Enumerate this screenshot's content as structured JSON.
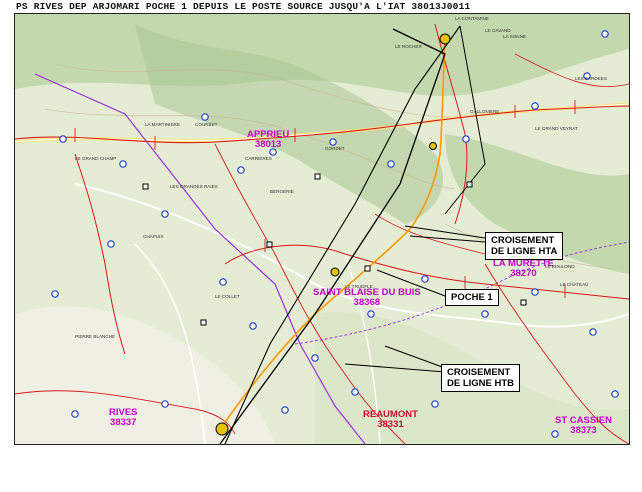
{
  "title": "PS RIVES DEP ARJOMARI POCHE 1 DEPUIS LE POSTE SOURCE JUSQU'A L'IAT 38013J0011",
  "communes": [
    {
      "name": "APPRIEU",
      "code": "38013",
      "color": "#c400c8"
    },
    {
      "name": "LA MURETTE",
      "code": "38270",
      "color": "#c400c8"
    },
    {
      "name": "SAINT BLAISE DU BUIS",
      "code": "38368",
      "color": "#c400c8"
    },
    {
      "name": "RIVES",
      "code": "38337",
      "color": "#c400c8"
    },
    {
      "name": "REAUMONT",
      "code": "38331",
      "color": "#c8102e"
    },
    {
      "name": "ST CASSIEN",
      "code": "38373",
      "color": "#c400c8"
    }
  ],
  "callouts": {
    "hta": "CROISEMENT\nDE LIGNE HTA",
    "poche": "POCHE 1",
    "htb": "CROISEMENT\nDE LIGNE HTB"
  },
  "places": [
    "LE GRAND CHAMP",
    "LA MARTINIERE",
    "LES GRANDES RAIES",
    "COURBET",
    "LE COLLET",
    "BERGERIE",
    "CHAPUIS",
    "PIERRE BLANCHE",
    "LA CONTAMINE",
    "LA SONNE",
    "LE BOULOND",
    "LE CHATEAU",
    "LES BARDEES",
    "LE GRAND VEYRAT",
    "GALLONIERE",
    "LE TRUEFLE",
    "LE GAVAND",
    "CARRIERES",
    "GORDET",
    "LE ROCHER"
  ],
  "colors": {
    "route": "#000000",
    "hta": "#d81b1b",
    "bt": "#ff9900",
    "boundary": "#9a30e0",
    "substation": "#1f3fcc"
  }
}
